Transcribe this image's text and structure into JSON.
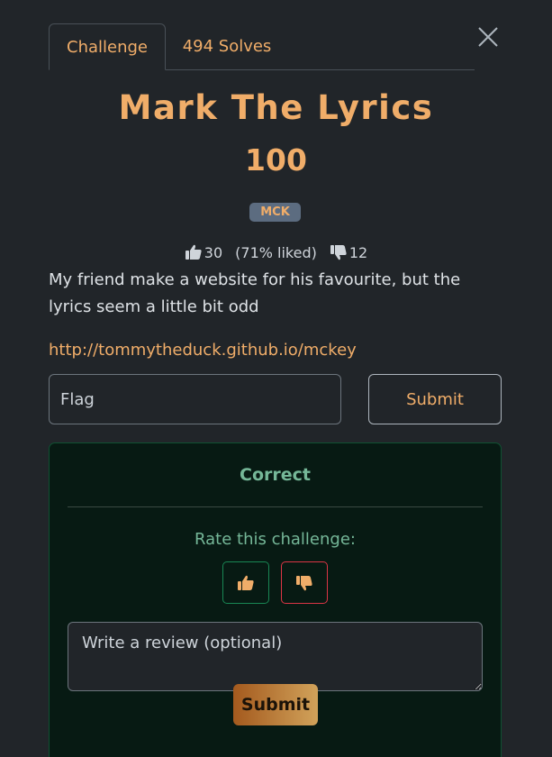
{
  "tabs": {
    "challenge": "Challenge",
    "solves": "494 Solves"
  },
  "challenge": {
    "name": "Mark The Lyrics",
    "points": "100",
    "category": "MCK",
    "likes": "30",
    "liked_pct": "(71% liked)",
    "dislikes": "12",
    "description": "My friend make a website for his favourite, but the lyrics seem a little bit odd",
    "link": "http://tommytheduck.github.io/mckey"
  },
  "flag_form": {
    "placeholder": "Flag",
    "submit_label": "Submit"
  },
  "result": {
    "status": "Correct",
    "rate_prompt": "Rate this challenge:",
    "review_placeholder": "Write a review (optional)",
    "review_submit_label": "Submit"
  },
  "colors": {
    "accent": "#f0ad69",
    "success": "#75b798",
    "danger": "#dc3545",
    "background": "#212529"
  },
  "icons": {
    "close": "close-icon",
    "like": "thumbs-up-icon",
    "dislike": "thumbs-down-icon"
  }
}
